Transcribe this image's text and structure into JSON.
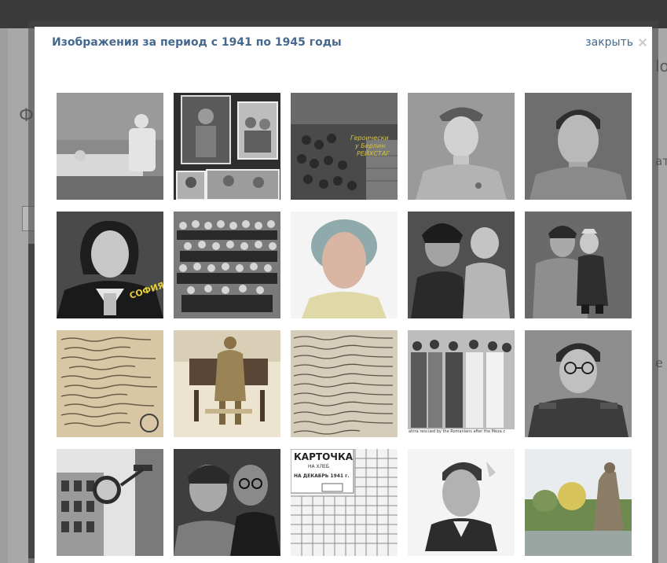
{
  "modal": {
    "title": "Изображения за период с 1941 по 1945 годы",
    "close_label": "закрыть",
    "close_icon": "close-x-icon"
  },
  "background": {
    "fragments": [
      "Ф",
      "lo",
      "ат",
      "е"
    ]
  },
  "photos": [
    {
      "id": "photo-1",
      "subject": "hospital-ward"
    },
    {
      "id": "photo-2",
      "subject": "album-page-collage"
    },
    {
      "id": "photo-3",
      "subject": "soldiers-on-steps",
      "caption_lines": [
        "Героически",
        "у Берлин",
        "РЕЙХСТАГ"
      ]
    },
    {
      "id": "photo-4",
      "subject": "soldier-portrait-cap"
    },
    {
      "id": "photo-5",
      "subject": "man-portrait"
    },
    {
      "id": "photo-6",
      "subject": "woman-portrait",
      "caption": "СОФИЯ"
    },
    {
      "id": "photo-7",
      "subject": "group-photo"
    },
    {
      "id": "photo-8",
      "subject": "elderly-woman-color"
    },
    {
      "id": "photo-9",
      "subject": "mother-and-child"
    },
    {
      "id": "photo-10",
      "subject": "woman-with-girl"
    },
    {
      "id": "photo-11",
      "subject": "handwritten-letter"
    },
    {
      "id": "photo-12",
      "subject": "soldier-at-piano-painting"
    },
    {
      "id": "photo-13",
      "subject": "handwritten-letter-2"
    },
    {
      "id": "photo-14",
      "subject": "crowd-of-soldiers",
      "caption": "ahira rescued by the Romanians after the Meza c"
    },
    {
      "id": "photo-15",
      "subject": "man-with-glasses-uniform"
    },
    {
      "id": "photo-16",
      "subject": "street-clock"
    },
    {
      "id": "photo-17",
      "subject": "couple-portrait"
    },
    {
      "id": "photo-18",
      "subject": "ration-card",
      "caption_lines": [
        "КАРТОЧКА",
        "НА ХЛЕБ",
        "НА ДЕКАБРЬ 1941 г."
      ]
    },
    {
      "id": "photo-19",
      "subject": "young-man-portrait"
    },
    {
      "id": "photo-20",
      "subject": "memorial-statue"
    }
  ],
  "colors": {
    "title": "#45688e",
    "close_icon": "#c5c8cc",
    "modal_bg": "#ffffff",
    "overlay": "#9e9e9e"
  }
}
